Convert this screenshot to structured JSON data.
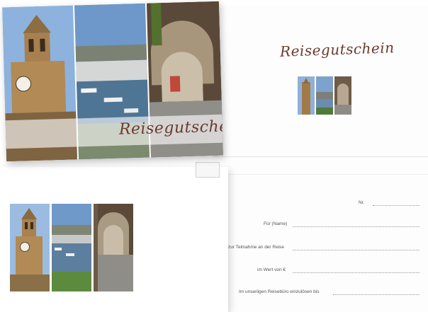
{
  "front_card": {
    "title": "Reisegutschein"
  },
  "inside_card": {
    "title": "Reisegutschein",
    "fields": [
      {
        "label": "Nr."
      },
      {
        "label": "Für (Name)"
      },
      {
        "label": "zur Teilnahme an der Reise"
      },
      {
        "label": "im Wert von €"
      },
      {
        "label": "Im unseriigen Reisebüro einzulösen bis"
      }
    ]
  },
  "colors": {
    "script_text": "#6b3a2e",
    "sky": "#7fa7d6",
    "stone": "#b28a5a",
    "sea": "#4c6e8e"
  }
}
